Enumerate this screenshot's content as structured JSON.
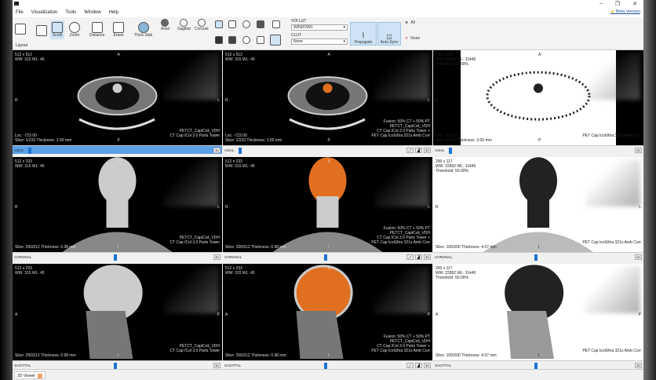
{
  "menu": [
    "File",
    "Visualization",
    "Tools",
    "Window",
    "Help"
  ],
  "beta": "Beta Version",
  "toolbar": {
    "layout": "Layout",
    "scroll": "Scroll",
    "zoom": "Zoom",
    "distance": "Distance",
    "erase": "Erase",
    "thick_slab": "Thick Slab",
    "axial": "Axial",
    "sagittal": "Sagittal",
    "coronal": "Coronal",
    "voi_lut_label": "VOI LUT",
    "voi_lut_value": "WINDOW1",
    "clut_label": "CLUT",
    "clut_value": "None",
    "propagate": "Propagate",
    "auto_sync": "Auto-Sync",
    "all": "All",
    "none": "None"
  },
  "viewports": [
    {
      "type": "ct",
      "line1": "512 x 512",
      "line2": "WW: 315 WL: 45",
      "loc": "Loc: -722.00",
      "slice": "Slice: 1/233 Thickness: 3.00 mm",
      "br": [
        "PETCT_CapiColi_VDH",
        "CT Cap ICol 3.0 Parts Tower"
      ],
      "top": "A",
      "bottom": "P",
      "left": "R",
      "right": "L",
      "orient": "AXIAL",
      "pos": 0.0,
      "active": true
    },
    {
      "type": "fusion",
      "line1": "512 x 512",
      "line2": "WW: 315 WL: 45",
      "loc": "Loc: -722.00",
      "slice": "Slice: 1/233 Thickness: 3.00 mm",
      "br": [
        "Fusion: 50% CT + 50% PT",
        "PETCT_CapiColi_VDH",
        "CT Cap ICol 3.0 Parts Tower +",
        "PET Cap IcolUltra 321s Amb Corr"
      ],
      "top": "A",
      "bottom": "P",
      "left": "R",
      "right": "L",
      "orient": "AXIAL",
      "pos": 0.0
    },
    {
      "type": "pet",
      "line1": "200 x 200",
      "line2": "WW: 22892 WL: 11446",
      "line3": "Threshold: 50.00%",
      "loc": "Loc: -722.00",
      "slice": "Slice: 1/117 Thickness: 3.00 mm",
      "br": [
        "PET Cap IcolUltra 321s Amb Corr"
      ],
      "top": "A",
      "bottom": "P",
      "left": "R",
      "right": "L",
      "orient": "AXIAL",
      "pos": 0.0
    },
    {
      "type": "ct",
      "line1": "512 x 233",
      "line2": "WW: 315 WL: 45",
      "slice": "Slice: 256/512 Thickness: 0.98 mm",
      "br": [
        "PETCT_CapiColi_VDH",
        "CT Cap ICol 3.0 Parts Tower"
      ],
      "top": "S",
      "bottom": "I",
      "left": "R",
      "right": "L",
      "orient": "CORONAL",
      "pos": 0.5
    },
    {
      "type": "fusion",
      "line1": "512 x 233",
      "line2": "WW: 315 WL: 45",
      "slice": "Slice: 256/512 Thickness: 0.98 mm",
      "br": [
        "Fusion: 50% CT + 50% PT",
        "PETCT_CapiColi_VDH",
        "CT Cap ICol 3.0 Parts Tower +",
        "PET Cap IcolUltra 321s Amb Corr"
      ],
      "top": "S",
      "bottom": "I",
      "left": "R",
      "right": "L",
      "orient": "CORONAL",
      "pos": 0.5
    },
    {
      "type": "pet",
      "line1": "200 x 117",
      "line2": "WW: 22892 WL: 11446",
      "line3": "Threshold: 50.00%",
      "slice": "Slice: 100/200 Thickness: 4.07 mm",
      "br": [
        "PET Cap IcolUltra 321s Amb Corr"
      ],
      "top": "S",
      "bottom": "I",
      "left": "R",
      "right": "L",
      "orient": "CORONAL",
      "pos": 0.5
    },
    {
      "type": "ct",
      "line1": "512 x 233",
      "line2": "WW: 315 WL: 45",
      "slice": "Slice: 256/512 Thickness: 0.98 mm",
      "br": [
        "PETCT_CapiColi_VDH",
        "CT Cap ICol 3.0 Parts Tower"
      ],
      "top": "S",
      "bottom": "I",
      "left": "A",
      "right": "P",
      "orient": "SAGITTAL",
      "pos": 0.5
    },
    {
      "type": "fusion",
      "line1": "512 x 233",
      "line2": "WW: 315 WL: 45",
      "slice": "Slice: 256/512 Thickness: 0.98 mm",
      "br": [
        "Fusion: 50% CT + 50% PT",
        "PETCT_CapiColi_VDH",
        "CT Cap ICol 3.0 Parts Tower +",
        "PET Cap IcolUltra 321s Amb Corr"
      ],
      "top": "S",
      "bottom": "I",
      "left": "A",
      "right": "P",
      "orient": "SAGITTAL",
      "pos": 0.5
    },
    {
      "type": "pet",
      "line1": "200 x 117",
      "line2": "WW: 22892 WL: 11446",
      "line3": "Threshold: 50.00%",
      "slice": "Slice: 100/200 Thickness: 4.07 mm",
      "br": [
        "PET Cap IcolUltra 321s Amb Corr"
      ],
      "top": "S",
      "bottom": "I",
      "left": "A",
      "right": "P",
      "orient": "SAGITTAL",
      "pos": 0.5
    }
  ],
  "status_tab": "2D Viewer"
}
